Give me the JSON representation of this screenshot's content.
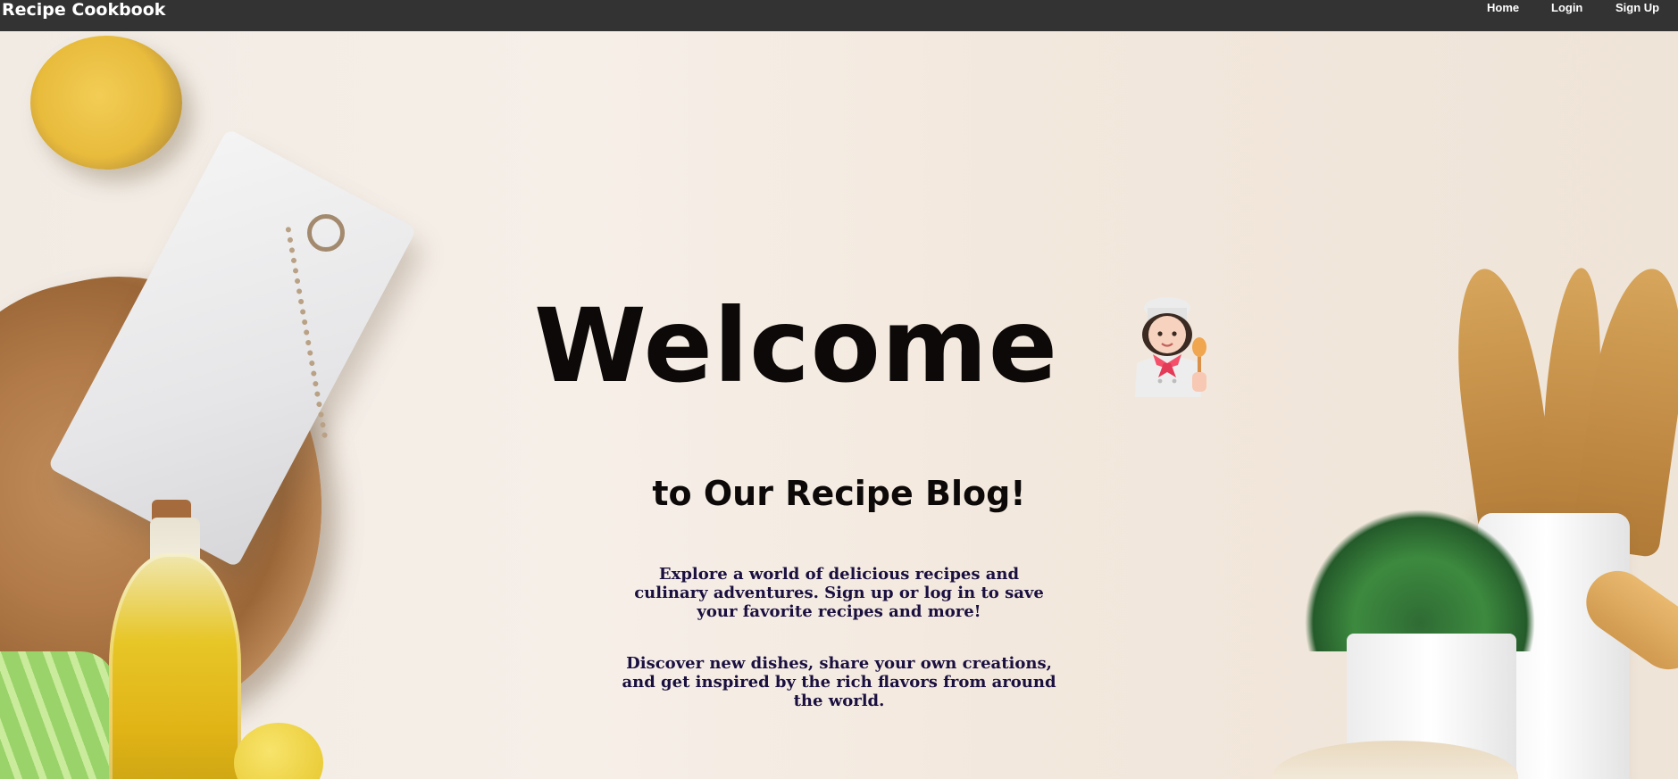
{
  "navbar": {
    "brand": "Recipe Cookbook",
    "links": [
      {
        "label": "Home"
      },
      {
        "label": "Login"
      },
      {
        "label": "Sign Up"
      }
    ]
  },
  "hero": {
    "title": "Welcome",
    "title_icon": "woman-cook-icon",
    "subtitle": "to Our Recipe Blog!",
    "paragraph_1": [
      "Explore a world of delicious recipes and",
      "culinary adventures. Sign up or log in to save",
      "your favorite recipes and more!"
    ],
    "paragraph_2": [
      "Discover new dishes, share your own creations,",
      "and get inspired by the rich flavors from around",
      "the world."
    ]
  },
  "colors": {
    "navbar_bg": "#333333",
    "nav_text": "#ffffff",
    "title_text": "#0c0908",
    "paragraph_text": "#1a1040"
  }
}
